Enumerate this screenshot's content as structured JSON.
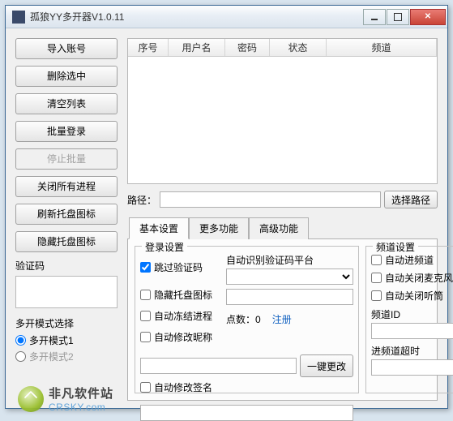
{
  "window": {
    "title": "孤狼YY多开器V1.0.11"
  },
  "sidebar": {
    "import": "导入账号",
    "delete": "删除选中",
    "clear": "清空列表",
    "batch_login": "批量登录",
    "stop_batch": "停止批量",
    "close_all": "关闭所有进程",
    "refresh_tray": "刷新托盘图标",
    "hide_tray": "隐藏托盘图标",
    "captcha_label": "验证码",
    "mode_title": "多开模式选择",
    "mode1": "多开模式1",
    "mode2": "多开模式2"
  },
  "table": {
    "cols": {
      "idx": "序号",
      "user": "用户名",
      "pwd": "密码",
      "state": "状态",
      "channel": "频道"
    }
  },
  "path": {
    "label": "路径：",
    "value": "",
    "btn": "选择路径"
  },
  "tabs": {
    "basic": "基本设置",
    "more": "更多功能",
    "adv": "高级功能"
  },
  "login": {
    "legend": "登录设置",
    "skip_captcha": "跳过验证码",
    "hide_tray": "隐藏托盘图标",
    "freeze_proc": "自动冻结进程",
    "auto_nick": "自动修改昵称",
    "auto_sig": "自动修改签名",
    "platform_label": "自动识别验证码平台",
    "points_label": "点数：",
    "points_value": "0",
    "register": "注册",
    "one_key": "一键更改"
  },
  "channel": {
    "legend": "频道设置",
    "auto_enter": "自动进频道",
    "auto_close_mic": "自动关闭麦克风",
    "auto_close_speaker": "自动关闭听筒",
    "id_label": "频道ID",
    "timeout_label": "进频道超时"
  },
  "watermark": {
    "cn": "非凡软件站",
    "en": "CRSKY.com"
  }
}
